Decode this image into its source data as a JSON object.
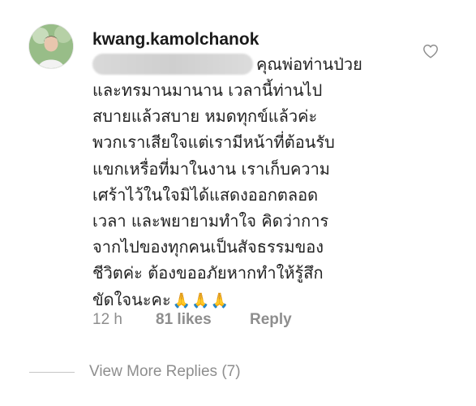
{
  "comment": {
    "username": "kwang.kamolchanok",
    "first_line": "คุณพ่อท่านป่วย",
    "lines": [
      "และทรมานมานาน เวลานี้ท่านไป",
      "สบายแล้วสบาย หมดทุกข์แล้วค่ะ",
      "พวกเราเสียใจแต่เรามีหน้าที่ต้อนรับ",
      "แขกเหรื่อที่มาในงาน เราเก็บความ",
      "เศร้าไว้ในใจมิได้แสดงออกตลอด",
      "เวลา และพยายามทำใจ คิดว่าการ",
      "จากไปของทุกคนเป็นสัจธรรมของ",
      "ชีวิตค่ะ ต้องขออภัยหากทำให้รู้สึก"
    ],
    "last_line": "ขัดใจนะคะ",
    "emoji": "🙏🙏🙏",
    "time": "12 h",
    "likes": "81 likes",
    "reply_label": "Reply",
    "view_replies": "View More Replies (7)"
  },
  "icons": {
    "heart": "heart-outline-icon"
  },
  "colors": {
    "text": "#262626",
    "meta": "#8e8e8e",
    "emoji": "#e3a21a"
  }
}
